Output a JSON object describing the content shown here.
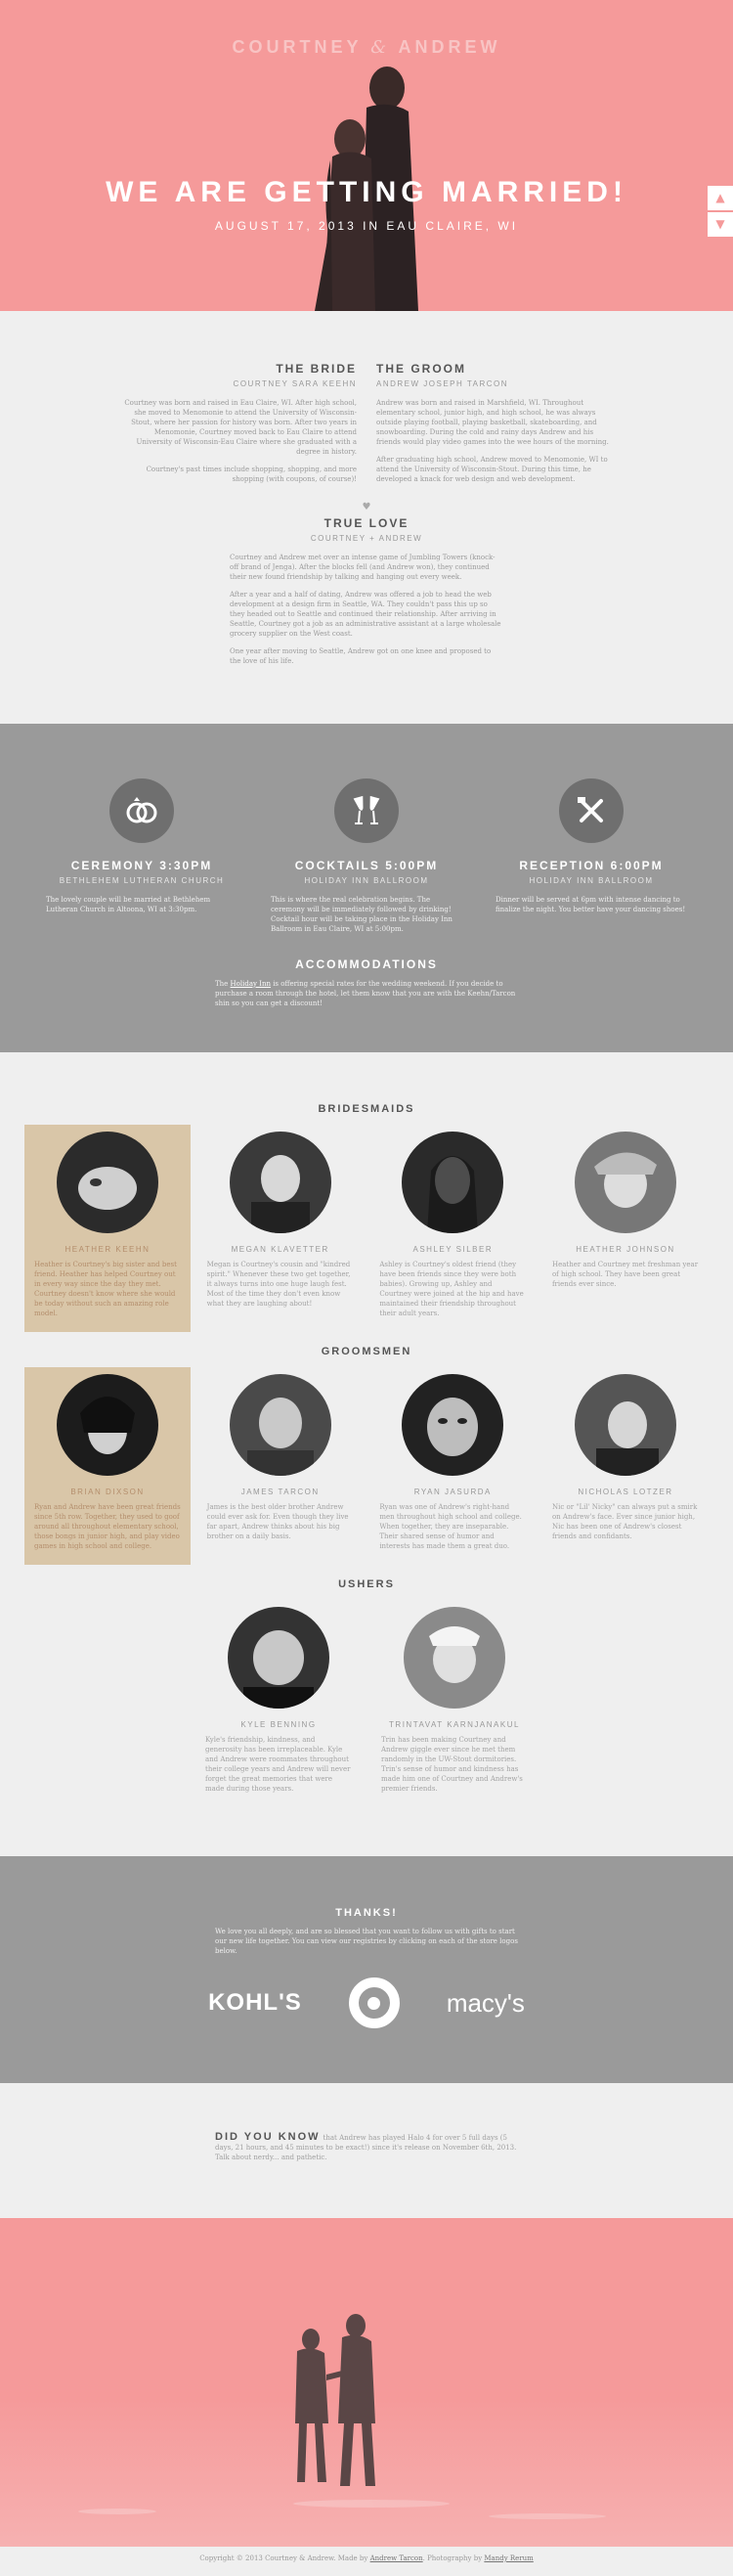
{
  "hero": {
    "couple_first": "COURTNEY",
    "couple_amp": "&",
    "couple_second": "ANDREW",
    "headline": "WE ARE GETTING MARRIED!",
    "date_line": "AUGUST 17, 2013 IN EAU CLAIRE, WI",
    "scroll_up": "▲",
    "scroll_down": "▼"
  },
  "story": {
    "bride": {
      "title": "THE BRIDE",
      "subtitle": "COURTNEY SARA KEEHN",
      "p1": "Courtney was born and raised in Eau Claire, WI. After high school, she moved to Menomonie to attend the University of Wisconsin-Stout, where her passion for history was born. After two years in Menomonie, Courtney moved back to Eau Claire to attend University of Wisconsin-Eau Claire where she graduated with a degree in history.",
      "p2": "Courtney's past times include shopping, shopping, and more shopping (with coupons, of course)!"
    },
    "groom": {
      "title": "THE GROOM",
      "subtitle": "ANDREW JOSEPH TARCON",
      "p1": "Andrew was born and raised in Marshfield, WI. Throughout elementary school, junior high, and high school, he was always outside playing football, playing basketball, skateboarding, and snowboarding. During the cold and rainy days Andrew and his friends would play video games into the wee hours of the morning.",
      "p2": "After graduating high school, Andrew moved to Menomonie, WI to attend the University of Wisconsin-Stout. During this time, he developed a knack for web design and web development."
    },
    "heart": "♥",
    "love": {
      "title": "TRUE LOVE",
      "subtitle": "COURTNEY + ANDREW",
      "p1": "Courtney and Andrew met over an intense game of Jumbling Towers (knock-off brand of Jenga). After the blocks fell (and Andrew won), they continued their new found friendship by talking and hanging out every week.",
      "p2": "After a year and a half of dating, Andrew was offered a job to head the web development at a design firm in Seattle, WA. They couldn't pass this up so they headed out to Seattle and continued their relationship. After arriving in Seattle, Courtney got a job as an administrative assistant at a large wholesale grocery supplier on the West coast.",
      "p3": "One year after moving to Seattle, Andrew got on one knee and proposed to the love of his life."
    }
  },
  "events": {
    "items": [
      {
        "title": "CEREMONY 3:30PM",
        "subtitle": "BETHLEHEM LUTHERAN CHURCH",
        "text": "The lovely couple will be married at Bethlehem Lutheran Church in Altoona, WI at 3:30pm."
      },
      {
        "title": "COCKTAILS 5:00PM",
        "subtitle": "HOLIDAY INN BALLROOM",
        "text": "This is where the real celebration begins. The ceremony will be immediately followed by drinking! Cocktail hour will be taking place in the Holiday Inn Ballroom in Eau Claire, WI at 5:00pm."
      },
      {
        "title": "RECEPTION 6:00PM",
        "subtitle": "HOLIDAY INN BALLROOM",
        "text": "Dinner will be served at 6pm with intense dancing to finalize the night. You better have your dancing shoes!"
      }
    ],
    "accommodations": {
      "title": "ACCOMMODATIONS",
      "link": "Holiday Inn",
      "pre": "The ",
      "text": " is offering special rates for the wedding weekend. If you decide to purchase a room through the hotel, let them know that you are with the Keehn/Tarcon shin so you can get a discount!"
    }
  },
  "bridesmaids": {
    "title": "BRIDESMAIDS",
    "people": [
      {
        "name": "HEATHER KEEHN",
        "bio": "Heather is Courtney's big sister and best friend. Heather has helped Courtney out in every way since the day they met. Courtney doesn't know where she would be today without such an amazing role model."
      },
      {
        "name": "MEGAN KLAVETTER",
        "bio": "Megan is Courtney's cousin and \"kindred spirit.\" Whenever these two get together, it always turns into one huge laugh fest. Most of the time they don't even know what they are laughing about!"
      },
      {
        "name": "ASHLEY SILBER",
        "bio": "Ashley is Courtney's oldest friend (they have been friends since they were both babies). Growing up, Ashley and Courtney were joined at the hip and have maintained their friendship throughout their adult years."
      },
      {
        "name": "HEATHER JOHNSON",
        "bio": "Heather and Courtney met freshman year of high school. They have been great friends ever since."
      }
    ]
  },
  "groomsmen": {
    "title": "GROOMSMEN",
    "people": [
      {
        "name": "BRIAN DIXSON",
        "bio": "Ryan and Andrew have been great friends since 5th row. Together, they used to goof around all throughout elementary school, those bongs in junior high, and play video games in high school and college."
      },
      {
        "name": "JAMES TARCON",
        "bio": "James is the best older brother Andrew could ever ask for. Even though they live far apart, Andrew thinks about his big brother on a daily basis."
      },
      {
        "name": "RYAN JASURDA",
        "bio": "Ryan was one of Andrew's right-hand men throughout high school and college. When together, they are inseparable. Their shared sense of humor and interests has made them a great duo."
      },
      {
        "name": "NICHOLAS LOTZER",
        "bio": "Nic or \"Lil' Nicky\" can always put a smirk on Andrew's face. Ever since junior high, Nic has been one of Andrew's closest friends and confidants."
      }
    ]
  },
  "ushers": {
    "title": "USHERS",
    "people": [
      {
        "name": "KYLE BENNING",
        "bio": "Kyle's friendship, kindness, and generosity has been irreplaceable. Kyle and Andrew were roommates throughout their college years and Andrew will never forget the great memories that were made during those years."
      },
      {
        "name": "TRINTAVAT KARNJANAKUL",
        "bio": "Trin has been making Courtney and Andrew giggle ever since he met them randomly in the UW-Stout dormitories. Trin's sense of humor and kindness has made him one of Courtney and Andrew's premier friends."
      }
    ]
  },
  "thanks": {
    "title": "THANKS!",
    "text": "We love you all deeply, and are so blessed that you want to follow us with gifts to start our new life together. You can view our registries by clicking on each of the store logos below.",
    "registries": [
      "KOHL'S",
      "target",
      "macy's"
    ]
  },
  "dyk": {
    "label": "DID YOU KNOW",
    "text": "that Andrew has played Halo 4 for over 5 full days (5 days, 21 hours, and 45 minutes to be exact!) since it's release on November 6th, 2013. Talk about nerdy... and pathetic."
  },
  "footer": {
    "pre": "Copyright © 2013 Courtney & Andrew. Made by ",
    "link1": "Andrew Tarcon",
    "mid": ". Photography by ",
    "link2": "Mandy Rerum"
  },
  "colors": {
    "hero_pink": "#f59a9a",
    "gray_band": "#9a9a9a",
    "light_bg": "#efefef",
    "highlight_tan": "#d9c6a8"
  }
}
